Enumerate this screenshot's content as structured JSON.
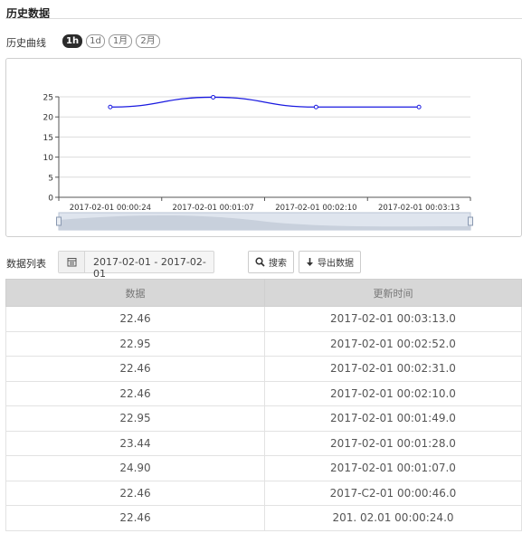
{
  "section": {
    "title": "历史数据"
  },
  "curve": {
    "label": "历史曲线",
    "ranges": [
      {
        "label": "1h",
        "active": true
      },
      {
        "label": "1d",
        "active": false
      },
      {
        "label": "1月",
        "active": false
      },
      {
        "label": "2月",
        "active": false
      }
    ]
  },
  "chart_data": {
    "type": "line",
    "x": [
      "2017-02-01 00:00:24",
      "2017-02-01 00:01:07",
      "2017-02-01 00:02:10",
      "2017-02-01 00:03:13"
    ],
    "values": [
      22.46,
      24.9,
      22.46,
      22.46
    ],
    "ylim": [
      0,
      25
    ],
    "yticks": [
      0,
      5,
      10,
      15,
      20,
      25
    ],
    "grid": true,
    "line_color": "#1a1ae0",
    "has_zoom_slider": true
  },
  "list": {
    "label": "数据列表",
    "date_range": "2017-02-01 - 2017-02-01",
    "search_button": "搜索",
    "export_button": "导出数据"
  },
  "table": {
    "headers": [
      "数据",
      "更新时间"
    ],
    "rows": [
      [
        "22.46",
        "2017-02-01 00:03:13.0"
      ],
      [
        "22.95",
        "2017-02-01 00:02:52.0"
      ],
      [
        "22.46",
        "2017-02-01 00:02:31.0"
      ],
      [
        "22.46",
        "2017-02-01 00:02:10.0"
      ],
      [
        "22.95",
        "2017-02-01 00:01:49.0"
      ],
      [
        "23.44",
        "2017-02-01 00:01:28.0"
      ],
      [
        "24.90",
        "2017-02-01 00:01:07.0"
      ],
      [
        "22.46",
        "2017-C2-01 00:00:46.0"
      ],
      [
        "22.46",
        "201. 02.01 00:00:24.0"
      ]
    ]
  }
}
